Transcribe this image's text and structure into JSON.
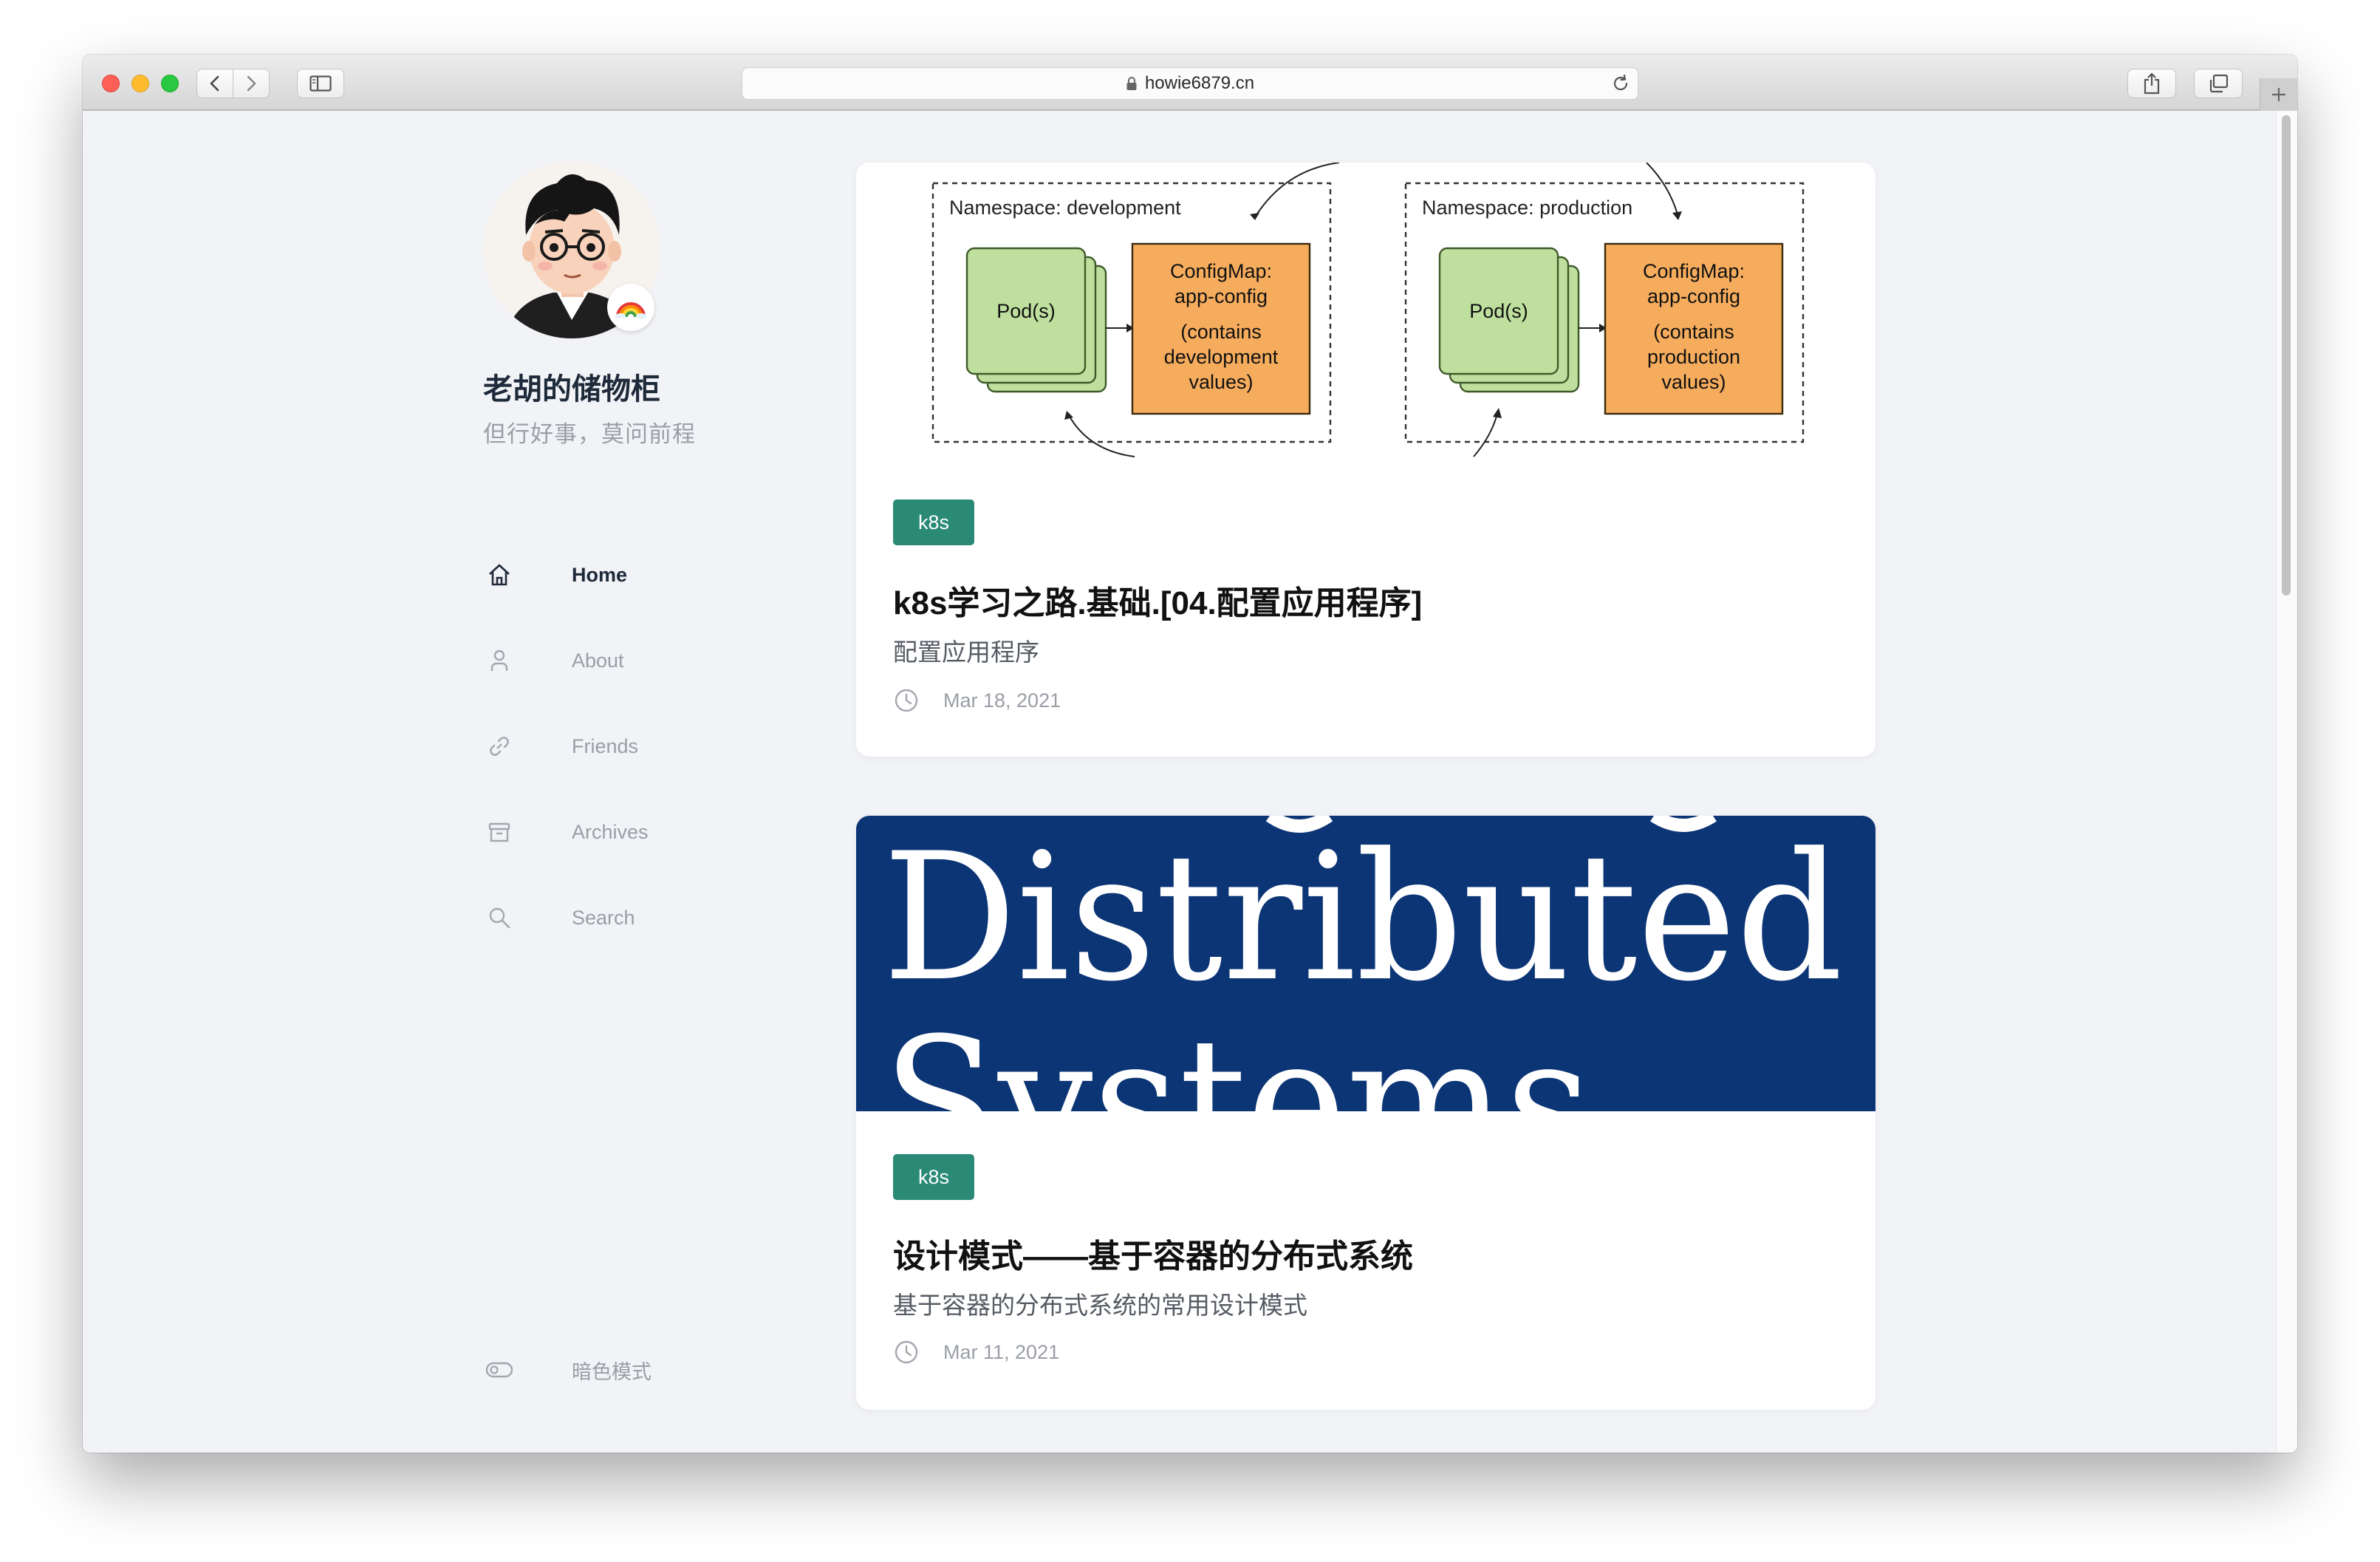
{
  "browser": {
    "url": "howie6879.cn",
    "traffic_lights": [
      "#fe5f57",
      "#febc2e",
      "#28c840"
    ]
  },
  "sidebar": {
    "site_title": "老胡的储物柜",
    "site_subtitle": "但行好事，莫问前程",
    "nav": [
      {
        "label": "Home",
        "icon": "home-icon",
        "active": true
      },
      {
        "label": "About",
        "icon": "user-icon",
        "active": false
      },
      {
        "label": "Friends",
        "icon": "link-icon",
        "active": false
      },
      {
        "label": "Archives",
        "icon": "archive-icon",
        "active": false
      },
      {
        "label": "Search",
        "icon": "search-icon",
        "active": false
      }
    ],
    "dark_mode_label": "暗色模式"
  },
  "posts": [
    {
      "tag": "k8s",
      "title": "k8s学习之路.基础.[04.配置应用程序]",
      "description": "配置应用程序",
      "date": "Mar 18, 2021",
      "cover": {
        "namespaces": [
          {
            "label": "Namespace: development",
            "pod": "Pod(s)",
            "configmap": [
              "ConfigMap:",
              "app-config",
              "",
              "(contains",
              "development",
              "values)"
            ]
          },
          {
            "label": "Namespace: production",
            "pod": "Pod(s)",
            "configmap": [
              "ConfigMap:",
              "app-config",
              "",
              "(contains",
              "production",
              "values)"
            ]
          }
        ]
      }
    },
    {
      "tag": "k8s",
      "title": "设计模式——基于容器的分布式系统",
      "description": "基于容器的分布式系统的常用设计模式",
      "date": "Mar 11, 2021",
      "cover": {
        "line1": "Distributed",
        "line2": "Systems",
        "background": "#0c3575"
      }
    }
  ],
  "colors": {
    "tag": "#2a8a76",
    "page_bg": "#f2f3f7",
    "title": "#1e2a3a",
    "muted": "#9a9ea6"
  }
}
